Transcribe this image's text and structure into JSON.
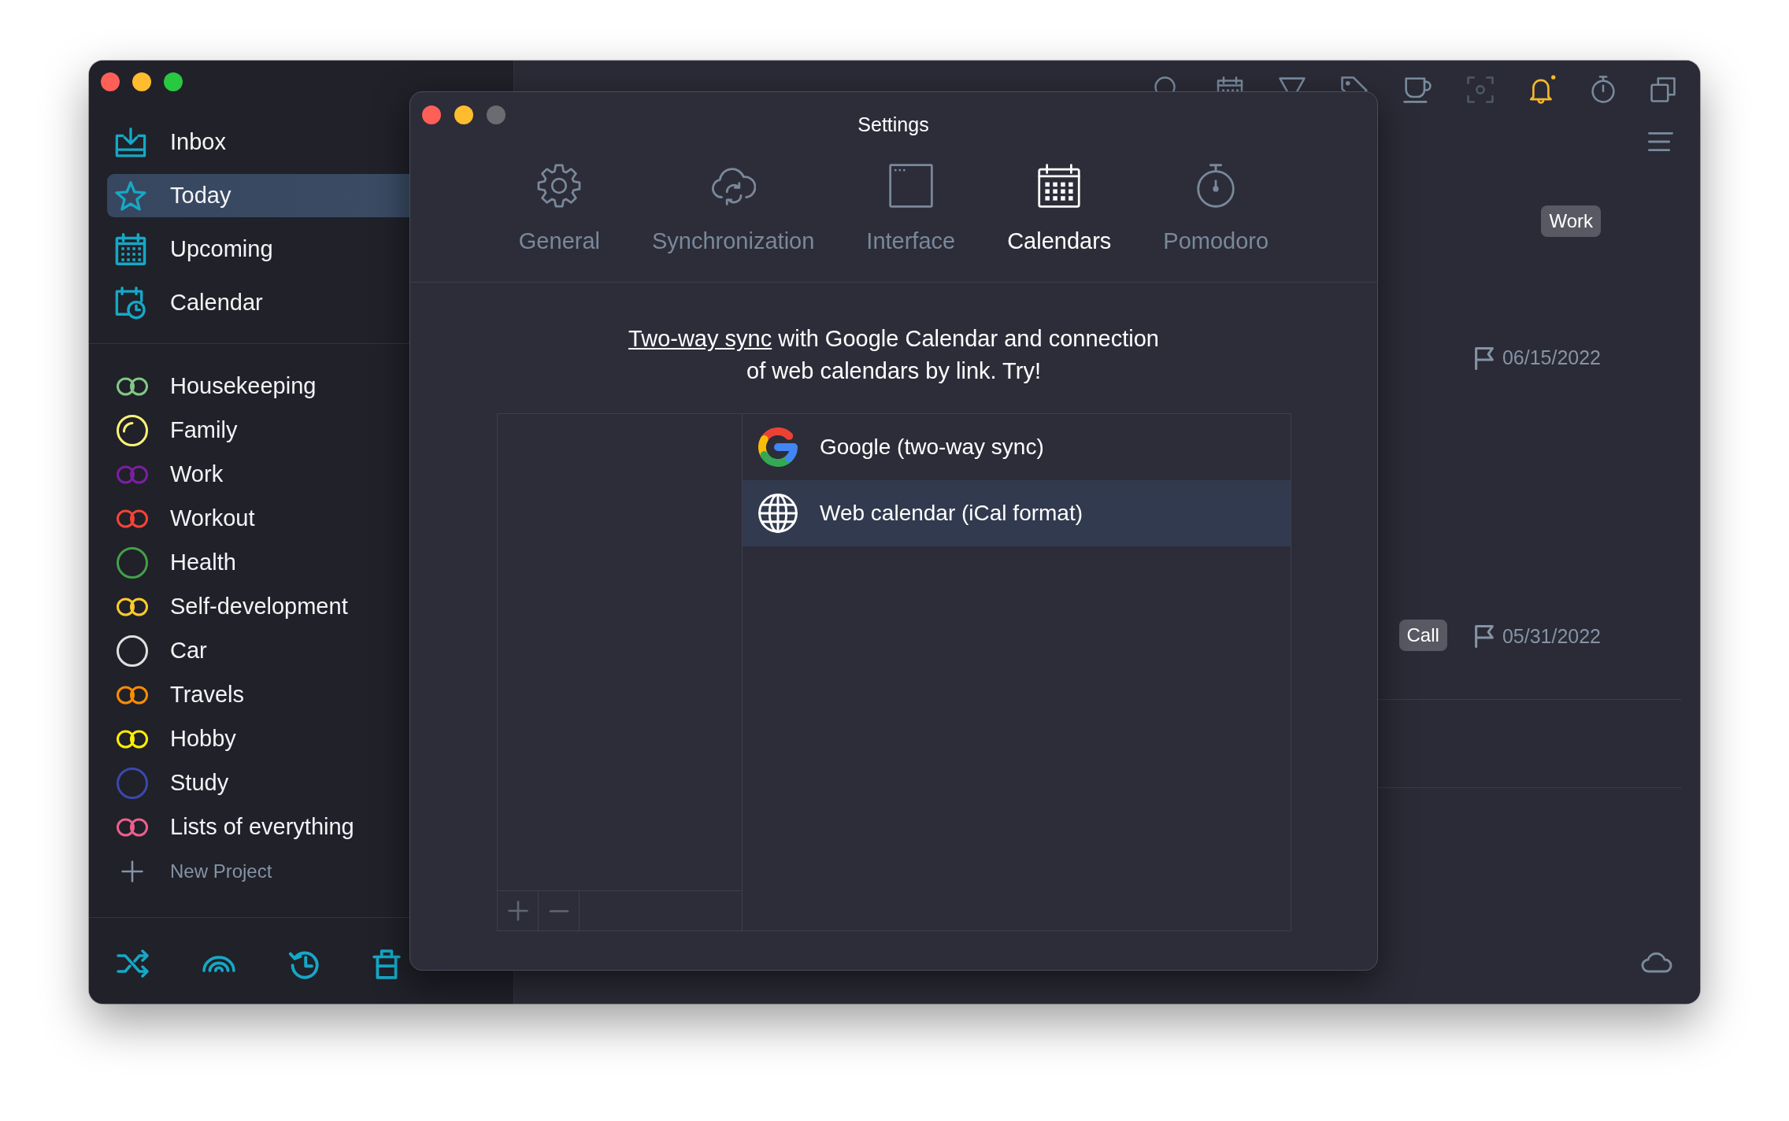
{
  "sidebar": {
    "nav": [
      {
        "label": "Inbox",
        "selected": false
      },
      {
        "label": "Today",
        "selected": true
      },
      {
        "label": "Upcoming",
        "selected": false
      },
      {
        "label": "Calendar",
        "selected": false
      }
    ],
    "projects": [
      {
        "label": "Housekeeping",
        "kind": "pair",
        "color": "#81c784"
      },
      {
        "label": "Family",
        "kind": "ring-arc",
        "color": "#fff176"
      },
      {
        "label": "Work",
        "kind": "pair",
        "color": "#7b1fa2"
      },
      {
        "label": "Workout",
        "kind": "pair",
        "color": "#f44336"
      },
      {
        "label": "Health",
        "kind": "ring",
        "color": "#43a047"
      },
      {
        "label": "Self-development",
        "kind": "pair",
        "color": "#ffca28"
      },
      {
        "label": "Car",
        "kind": "ring",
        "color": "#e0e0e0"
      },
      {
        "label": "Travels",
        "kind": "pair",
        "color": "#fb8c00"
      },
      {
        "label": "Hobby",
        "kind": "pair",
        "color": "#ffee00"
      },
      {
        "label": "Study",
        "kind": "ring",
        "color": "#3949ab"
      },
      {
        "label": "Lists of everything",
        "kind": "pair",
        "color": "#ec5f8b"
      }
    ],
    "new_project": "New Project"
  },
  "toolbar": {
    "notification_alert": true
  },
  "tasks": [
    {
      "tag": "Work"
    },
    {
      "due": "06/15/2022"
    },
    {
      "tag": "Call",
      "due": "05/31/2022"
    }
  ],
  "dialog": {
    "title": "Settings",
    "zoom_enabled": false,
    "tabs": [
      {
        "label": "General",
        "selected": false
      },
      {
        "label": "Synchronization",
        "selected": false
      },
      {
        "label": "Interface",
        "selected": false
      },
      {
        "label": "Calendars",
        "selected": true
      },
      {
        "label": "Pomodoro",
        "selected": false
      }
    ],
    "intro": {
      "link": "Two-way sync",
      "text": " with Google Calendar and connection of web calendars by link. Try!"
    },
    "sources": [
      {
        "label": "Google (two-way sync)",
        "selected": false
      },
      {
        "label": "Web calendar (iCal format)",
        "selected": true
      }
    ]
  }
}
